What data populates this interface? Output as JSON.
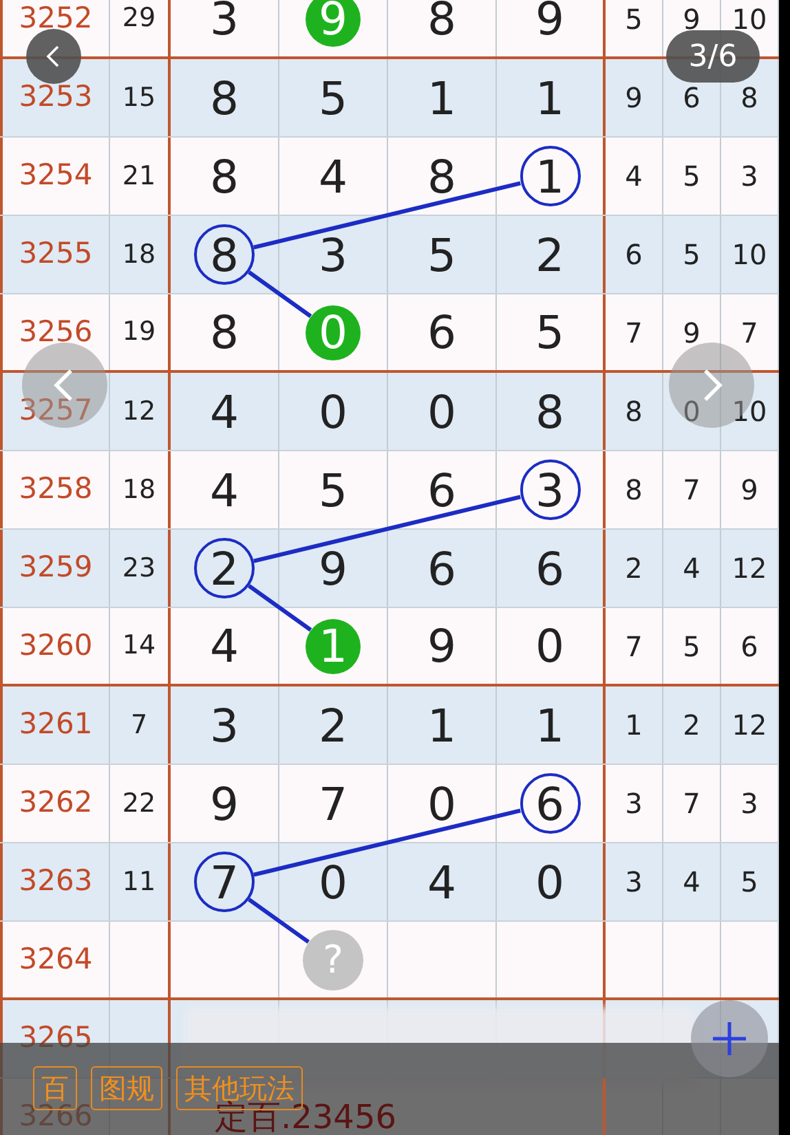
{
  "page_indicator": "3/6",
  "rows": [
    {
      "issue": "3252",
      "sum": "29",
      "digits": [
        {
          "value": "3",
          "kind": "plain"
        },
        {
          "value": "9",
          "kind": "hit"
        },
        {
          "value": "8",
          "kind": "plain"
        },
        {
          "value": "9",
          "kind": "plain"
        }
      ],
      "extras": [
        "5",
        "9",
        "10"
      ]
    },
    {
      "issue": "3253",
      "sum": "15",
      "digits": [
        {
          "value": "8",
          "kind": "plain"
        },
        {
          "value": "5",
          "kind": "plain"
        },
        {
          "value": "1",
          "kind": "plain"
        },
        {
          "value": "1",
          "kind": "plain"
        }
      ],
      "extras": [
        "9",
        "6",
        "8"
      ]
    },
    {
      "issue": "3254",
      "sum": "21",
      "digits": [
        {
          "value": "8",
          "kind": "plain"
        },
        {
          "value": "4",
          "kind": "plain"
        },
        {
          "value": "8",
          "kind": "plain"
        },
        {
          "value": "1",
          "kind": "ring"
        }
      ],
      "extras": [
        "4",
        "5",
        "3"
      ]
    },
    {
      "issue": "3255",
      "sum": "18",
      "digits": [
        {
          "value": "8",
          "kind": "ring"
        },
        {
          "value": "3",
          "kind": "plain"
        },
        {
          "value": "5",
          "kind": "plain"
        },
        {
          "value": "2",
          "kind": "plain"
        }
      ],
      "extras": [
        "6",
        "5",
        "10"
      ]
    },
    {
      "issue": "3256",
      "sum": "19",
      "digits": [
        {
          "value": "8",
          "kind": "plain"
        },
        {
          "value": "0",
          "kind": "hit"
        },
        {
          "value": "6",
          "kind": "plain"
        },
        {
          "value": "5",
          "kind": "plain"
        }
      ],
      "extras": [
        "7",
        "9",
        "7"
      ]
    },
    {
      "issue": "3257",
      "sum": "12",
      "digits": [
        {
          "value": "4",
          "kind": "plain"
        },
        {
          "value": "0",
          "kind": "plain"
        },
        {
          "value": "0",
          "kind": "plain"
        },
        {
          "value": "8",
          "kind": "plain"
        }
      ],
      "extras": [
        "8",
        "0",
        "10"
      ]
    },
    {
      "issue": "3258",
      "sum": "18",
      "digits": [
        {
          "value": "4",
          "kind": "plain"
        },
        {
          "value": "5",
          "kind": "plain"
        },
        {
          "value": "6",
          "kind": "plain"
        },
        {
          "value": "3",
          "kind": "ring"
        }
      ],
      "extras": [
        "8",
        "7",
        "9"
      ]
    },
    {
      "issue": "3259",
      "sum": "23",
      "digits": [
        {
          "value": "2",
          "kind": "ring"
        },
        {
          "value": "9",
          "kind": "plain"
        },
        {
          "value": "6",
          "kind": "plain"
        },
        {
          "value": "6",
          "kind": "plain"
        }
      ],
      "extras": [
        "2",
        "4",
        "12"
      ]
    },
    {
      "issue": "3260",
      "sum": "14",
      "digits": [
        {
          "value": "4",
          "kind": "plain"
        },
        {
          "value": "1",
          "kind": "hit"
        },
        {
          "value": "9",
          "kind": "plain"
        },
        {
          "value": "0",
          "kind": "plain"
        }
      ],
      "extras": [
        "7",
        "5",
        "6"
      ]
    },
    {
      "issue": "3261",
      "sum": "7",
      "digits": [
        {
          "value": "3",
          "kind": "plain"
        },
        {
          "value": "2",
          "kind": "plain"
        },
        {
          "value": "1",
          "kind": "plain"
        },
        {
          "value": "1",
          "kind": "plain"
        }
      ],
      "extras": [
        "1",
        "2",
        "12"
      ]
    },
    {
      "issue": "3262",
      "sum": "22",
      "digits": [
        {
          "value": "9",
          "kind": "plain"
        },
        {
          "value": "7",
          "kind": "plain"
        },
        {
          "value": "0",
          "kind": "plain"
        },
        {
          "value": "6",
          "kind": "ring"
        }
      ],
      "extras": [
        "3",
        "7",
        "3"
      ]
    },
    {
      "issue": "3263",
      "sum": "11",
      "digits": [
        {
          "value": "7",
          "kind": "ring"
        },
        {
          "value": "0",
          "kind": "plain"
        },
        {
          "value": "4",
          "kind": "plain"
        },
        {
          "value": "0",
          "kind": "plain"
        }
      ],
      "extras": [
        "3",
        "4",
        "5"
      ]
    },
    {
      "issue": "3264",
      "prediction": "?"
    },
    {
      "issue": "3265"
    },
    {
      "issue": "3266",
      "note": "定百.23456"
    }
  ],
  "toolbar": {
    "buttons": [
      "百",
      "图规",
      "其他玩法"
    ]
  }
}
